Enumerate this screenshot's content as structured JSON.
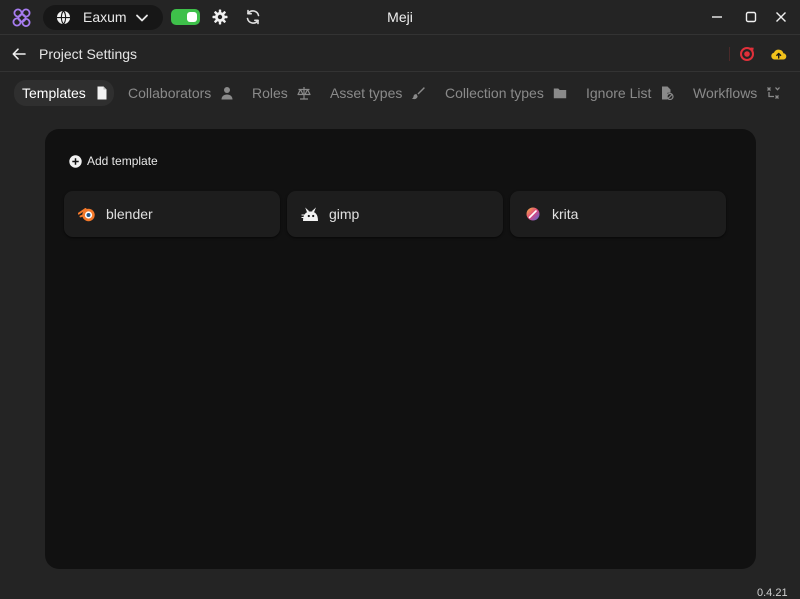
{
  "titlebar": {
    "app_title": "Meji",
    "workspace_name": "Eaxum",
    "toggle_color": "#3ec04a"
  },
  "header": {
    "page_title": "Project Settings"
  },
  "tabs": [
    {
      "label": "Templates",
      "icon": "document-icon",
      "active": true
    },
    {
      "label": "Collaborators",
      "icon": "person-icon",
      "active": false
    },
    {
      "label": "Roles",
      "icon": "scale-icon",
      "active": false
    },
    {
      "label": "Asset types",
      "icon": "brush-icon",
      "active": false
    },
    {
      "label": "Collection types",
      "icon": "folder-icon",
      "active": false
    },
    {
      "label": "Ignore List",
      "icon": "file-ignore-icon",
      "active": false
    },
    {
      "label": "Workflows",
      "icon": "workflow-icon",
      "active": false
    }
  ],
  "panel": {
    "add_label": "Add template",
    "templates": [
      {
        "name": "blender",
        "icon": "blender-icon"
      },
      {
        "name": "gimp",
        "icon": "gimp-icon"
      },
      {
        "name": "krita",
        "icon": "krita-icon"
      }
    ]
  },
  "footer": {
    "version": "0.4.21"
  },
  "colors": {
    "accent_green": "#3ec04a",
    "logo_purple": "#a77cf0",
    "sync_red": "#e0303a",
    "cloud_yellow": "#f2c21b"
  }
}
